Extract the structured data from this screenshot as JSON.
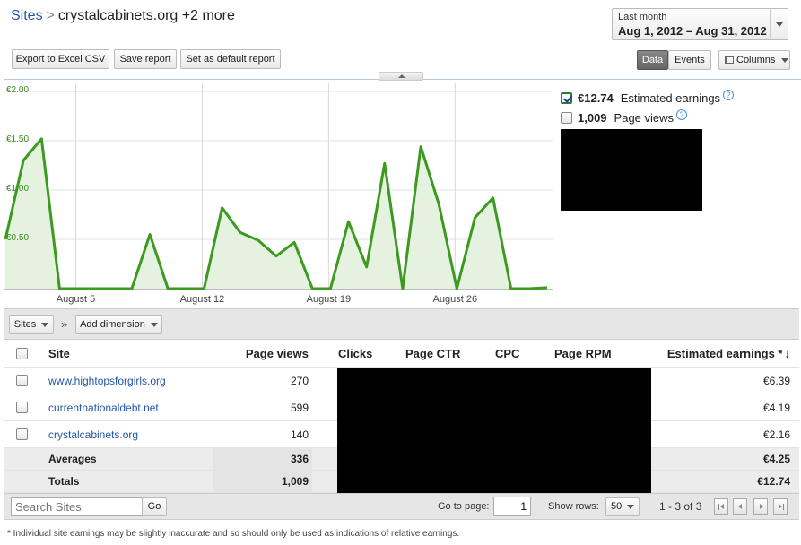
{
  "header": {
    "breadcrumb_root": "Sites",
    "breadcrumb_sep": ">",
    "breadcrumb_current": "crystalcabinets.org +2 more",
    "date_label": "Last month",
    "date_range": "Aug 1, 2012 – Aug 31, 2012"
  },
  "toolbar": {
    "export_label": "Export to Excel CSV",
    "save_label": "Save report",
    "default_label": "Set as default report",
    "data_label": "Data",
    "events_label": "Events",
    "columns_label": "Columns"
  },
  "chart_data": {
    "type": "line",
    "y_ticks": [
      "€2.00",
      "€1.50",
      "€1.00",
      "€0.50"
    ],
    "x_ticks": [
      "August 5",
      "August 12",
      "August 19",
      "August 26"
    ],
    "ylim": [
      0,
      2.0
    ],
    "xlim": [
      1,
      31
    ],
    "grid": true,
    "color": "#3b9a1f",
    "fill": "#e6f2e0",
    "x": [
      1,
      2,
      3,
      4,
      5,
      6,
      7,
      8,
      9,
      10,
      11,
      12,
      13,
      14,
      15,
      16,
      17,
      18,
      19,
      20,
      21,
      22,
      23,
      24,
      25,
      26,
      27,
      28,
      29,
      30,
      31
    ],
    "values": [
      0.5,
      1.3,
      1.52,
      0.0,
      0.0,
      0.0,
      0.0,
      0.0,
      0.55,
      0.0,
      0.0,
      0.0,
      0.82,
      0.57,
      0.49,
      0.33,
      0.47,
      0.0,
      0.0,
      0.68,
      0.22,
      1.27,
      0.0,
      1.44,
      0.86,
      0.0,
      0.72,
      0.92,
      0.0,
      0.0,
      0.01
    ]
  },
  "metrics": {
    "earnings_value": "€12.74",
    "earnings_label": "Estimated earnings",
    "pageviews_value": "1,009",
    "pageviews_label": "Page views",
    "help": "?"
  },
  "dimbar": {
    "sites_label": "Sites",
    "chevron": "»",
    "add_dimension_label": "Add dimension"
  },
  "table": {
    "headers": {
      "site": "Site",
      "page_views": "Page views",
      "clicks": "Clicks",
      "page_ctr": "Page CTR",
      "cpc": "CPC",
      "page_rpm": "Page RPM",
      "earnings": "Estimated earnings *"
    },
    "sort_arrow": "↓",
    "rows": [
      {
        "site": "www.hightopsforgirls.org",
        "page_views": "270",
        "earnings": "€6.39"
      },
      {
        "site": "currentnationaldebt.net",
        "page_views": "599",
        "earnings": "€4.19"
      },
      {
        "site": "crystalcabinets.org",
        "page_views": "140",
        "earnings": "€2.16"
      }
    ],
    "averages": {
      "label": "Averages",
      "page_views": "336",
      "earnings": "€4.25"
    },
    "totals": {
      "label": "Totals",
      "page_views": "1,009",
      "earnings": "€12.74"
    }
  },
  "footer": {
    "search_placeholder": "Search Sites",
    "go_label": "Go",
    "goto_label": "Go to page:",
    "goto_value": "1",
    "show_rows_label": "Show rows:",
    "show_rows_value": "50",
    "range": "1 - 3 of 3",
    "note": "* Individual site earnings may be slightly inaccurate and so should only be used as indications of relative earnings."
  }
}
